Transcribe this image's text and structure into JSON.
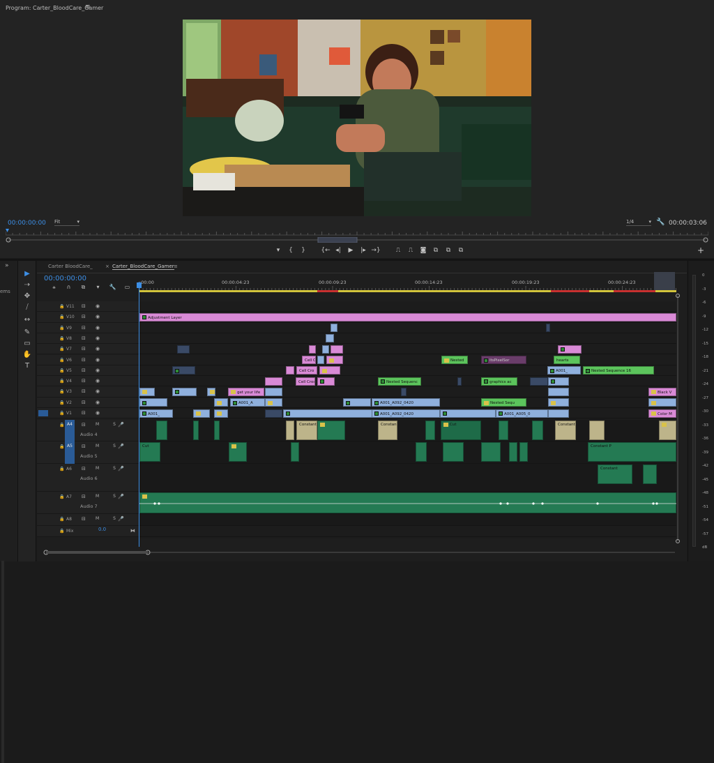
{
  "program": {
    "title": "Program: Carter_BloodCare_Gamer",
    "menu_icon": "≡",
    "timecode_in": "00:00:00:00",
    "fit_label": "Fit",
    "quality_label": "1/4",
    "timecode_duration": "00:00:03:06",
    "plus_icon": "+"
  },
  "transport": [
    "▾",
    "{",
    "}",
    "{←",
    "◂|",
    "▶",
    "|▸",
    "→}",
    "⎍",
    "⎍",
    "◙",
    "⧉",
    "⧉",
    "⧉"
  ],
  "left_strip": {
    "chevron": "»",
    "cut_text": "ems"
  },
  "tools": [
    "▶",
    "⇢",
    "✥",
    "⧸",
    "↔",
    "✎",
    "▭",
    "✋",
    "T"
  ],
  "timeline": {
    "tabs": [
      {
        "label": "Carter BloodCare_"
      },
      {
        "label": "Carter_BloodCare_Gamer"
      }
    ],
    "tab_close": "×",
    "tab_menu": "≡",
    "timecode": "00:00:00:00",
    "ruler": [
      ":00:00",
      "00:00:04:23",
      "00:00:09:23",
      "00:00:14:23",
      "00:00:19:23",
      "00:00:24:23"
    ],
    "video_tracks": [
      "V11",
      "V10",
      "V9",
      "V8",
      "V7",
      "V6",
      "V5",
      "V4",
      "V3",
      "V2",
      "V1"
    ],
    "audio_tracks": [
      {
        "id": "A4",
        "name": "Audio 4"
      },
      {
        "id": "A5",
        "name": "Audio 5"
      },
      {
        "id": "A6",
        "name": "Audio 6"
      },
      {
        "id": "A7",
        "name": "Audio 7"
      },
      {
        "id": "A8",
        "name": ""
      }
    ],
    "mix_label": "Mix",
    "mix_value": "0.0",
    "ms_labels": "M S",
    "clips": {
      "adjustment": "Adjustment Layer",
      "nested_v6": "Nested",
      "pixelsort": "ItsPixelSor",
      "hearts": "hearts",
      "nested_seq_16": "Nested Sequence 16",
      "a001_v5": "A001_",
      "nested_seq_v4": "Nested Sequenc",
      "graphics": "graphics ac",
      "get_life": "get your life",
      "black_v": "Black V",
      "a001_a": "A001_A",
      "a092_v2": "A001_A092_0420",
      "nested_seq_v2": "Nested Sequ",
      "a001_v1": "A001_",
      "a092_v1": "A001_A092_0420",
      "a005_v1": "A001_A005_0",
      "color_m": "Color M",
      "cell_cross": "Cell Cros",
      "crossfade": "Cell Cro",
      "constant": "Constant",
      "constant_p": "Constant P",
      "cut": "Cut"
    }
  },
  "meters": [
    "0",
    "-3",
    "-6",
    "-9",
    "-12",
    "-15",
    "-18",
    "-21",
    "-24",
    "-27",
    "-30",
    "-33",
    "-36",
    "-39",
    "-42",
    "-45",
    "-48",
    "-51",
    "-54",
    "-57",
    "dB"
  ],
  "colors": {
    "accent": "#3d8fe6",
    "adjustment": "#d98ad6",
    "video_clip": "#8fb0dd",
    "nested_clip": "#5cc45c",
    "audio_clip": "#247a53",
    "work_area": "#d2c43b"
  }
}
